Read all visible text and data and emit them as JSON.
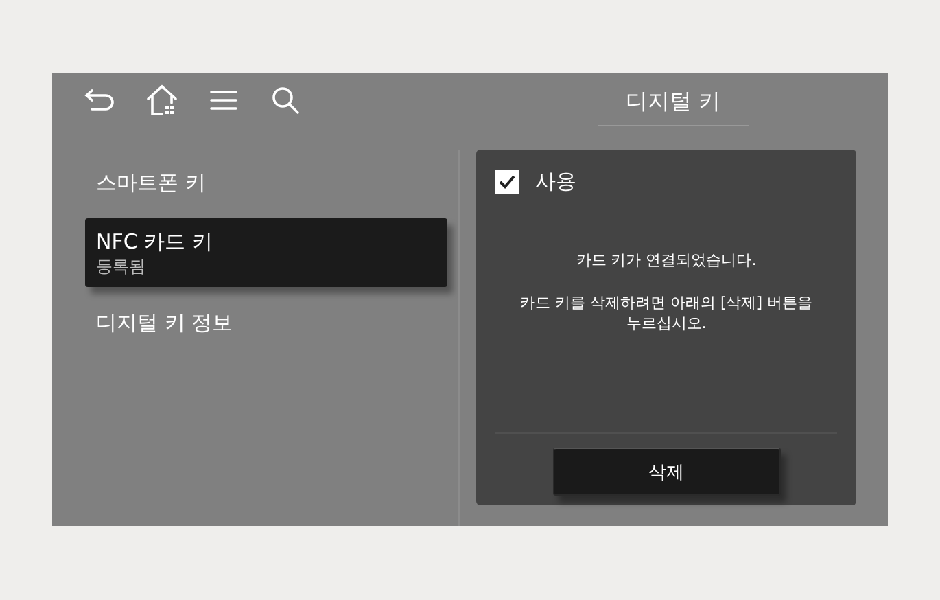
{
  "header": {
    "title": "디지털 키"
  },
  "menu": [
    {
      "label": "스마트폰 키",
      "selected": false
    },
    {
      "label": "NFC 카드 키",
      "sublabel": "등록됨",
      "selected": true
    },
    {
      "label": "디지털 키 정보",
      "selected": false
    }
  ],
  "panel": {
    "use_checkbox": {
      "label": "사용",
      "checked": true
    },
    "messages": [
      "카드 키가 연결되었습니다.",
      "카드 키를 삭제하려면 아래의 [삭제] 버튼을 누르십시오."
    ],
    "delete_button": "삭제"
  }
}
